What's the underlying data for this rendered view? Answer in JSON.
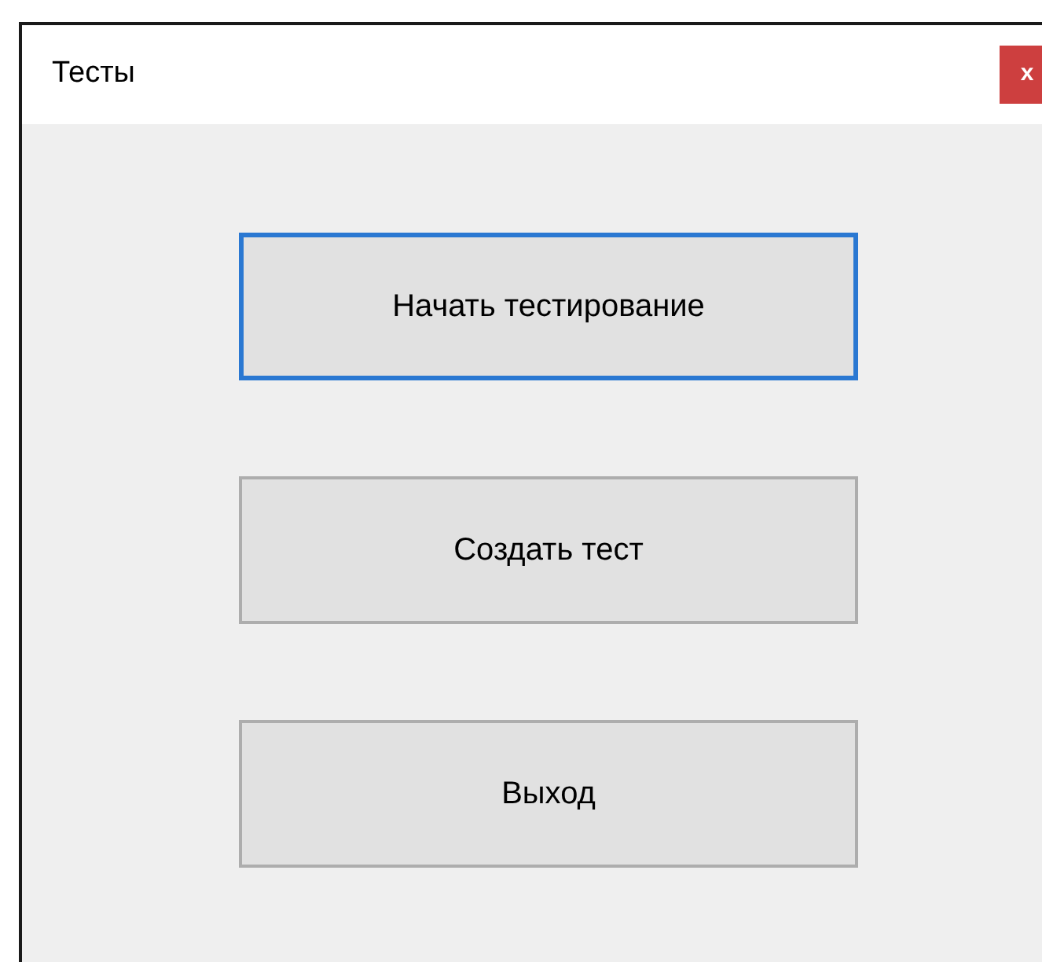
{
  "window": {
    "title": "Тесты",
    "close": "x"
  },
  "buttons": [
    {
      "label": "Начать тестирование",
      "focused": true
    },
    {
      "label": "Создать тест",
      "focused": false
    },
    {
      "label": "Выход",
      "focused": false
    }
  ]
}
